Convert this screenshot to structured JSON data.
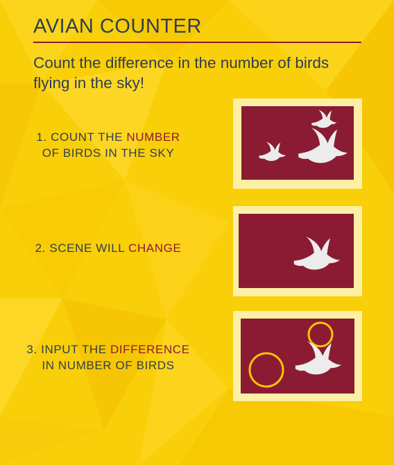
{
  "title": "AVIAN COUNTER",
  "subtitle": "Count the difference in the number of birds flying in the sky!",
  "steps": [
    {
      "number": "1.",
      "pre": "COUNT THE",
      "highlight": "NUMBER",
      "post": "OF BIRDS IN THE SKY",
      "birds_in_sky": 3
    },
    {
      "number": "2.",
      "pre": "SCENE WILL",
      "highlight": "CHANGE",
      "post": "",
      "birds_in_sky": 1
    },
    {
      "number": "3.",
      "pre": "INPUT THE",
      "highlight": "DIFFERENCE",
      "post": "IN NUMBER OF BIRDS",
      "birds_in_sky": 1
    }
  ],
  "colors": {
    "background": "#f9cf0a",
    "text": "#2f3e50",
    "accent": "#8b1b33",
    "panel_frame": "#fdf0a6",
    "sky": "#8b1b33",
    "bird": "#ececec",
    "ring": "#f7c600"
  },
  "icons": [
    "bird-icon",
    "circle-marker-icon"
  ]
}
